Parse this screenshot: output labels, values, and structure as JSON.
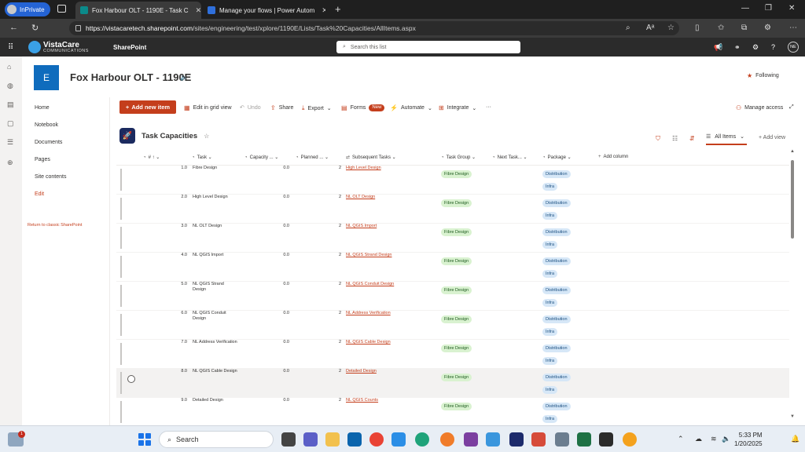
{
  "browser": {
    "inprivate_label": "InPrivate",
    "tabs": [
      {
        "title": "Fox Harbour OLT - 1190E - Task C",
        "active": true
      },
      {
        "title": "Manage your flows | Power Autom",
        "active": false
      }
    ],
    "url_host": "https://vistacaretech.sharepoint.com",
    "url_path": "/sites/engineering/test/xplore/1190E/Lists/Task%20Capacities/AllItems.aspx"
  },
  "suitebar": {
    "brand_name": "VistaCare",
    "brand_sub": "COMMUNICATIONS",
    "app_label": "SharePoint",
    "search_placeholder": "Search this list",
    "me_initials": "NE"
  },
  "site": {
    "logo_letter": "E",
    "title": "Fox Harbour OLT - 1190E",
    "following_label": "Following"
  },
  "leftnav": {
    "items": [
      "Home",
      "Notebook",
      "Documents",
      "Pages",
      "Site contents",
      "Edit"
    ],
    "classic_link": "Return to classic SharePoint"
  },
  "commandbar": {
    "new_item": "Add new item",
    "edit_grid": "Edit in grid view",
    "undo": "Undo",
    "share": "Share",
    "export": "Export",
    "forms": "Forms",
    "forms_badge": "New",
    "automate": "Automate",
    "integrate": "Integrate",
    "more": "···",
    "manage_access": "Manage access"
  },
  "list": {
    "title": "Task Capacities",
    "view_name": "All Items",
    "add_view": "Add view",
    "columns": [
      "#",
      "Task",
      "Capacity ...",
      "Planned ...",
      "Subsequent Tasks",
      "Task Group",
      "Next Task...",
      "Package",
      "Add column"
    ],
    "rows": [
      {
        "num": "1.0",
        "task": "Fibre Design",
        "capacity": "0.0",
        "planned": "2",
        "subsequent": "High Level Design",
        "group": "Fibre Design",
        "pkg1": "Distribution",
        "pkg2": "Infra"
      },
      {
        "num": "2.0",
        "task": "High Level Design",
        "capacity": "0.0",
        "planned": "2",
        "subsequent": "NL OLT Design",
        "group": "Fibre Design",
        "pkg1": "Distribution",
        "pkg2": "Infra"
      },
      {
        "num": "3.0",
        "task": "NL OLT Design",
        "capacity": "0.0",
        "planned": "2",
        "subsequent": "NL QGIS Import",
        "group": "Fibre Design",
        "pkg1": "Distribution",
        "pkg2": "Infra"
      },
      {
        "num": "4.0",
        "task": "NL QGIS Import",
        "capacity": "0.0",
        "planned": "2",
        "subsequent": "NL QGIS Strand Design",
        "group": "Fibre Design",
        "pkg1": "Distribution",
        "pkg2": "Infra"
      },
      {
        "num": "5.0",
        "task": "NL QGIS Strand Design",
        "capacity": "0.0",
        "planned": "2",
        "subsequent": "NL QGIS Conduit Design",
        "group": "Fibre Design",
        "pkg1": "Distribution",
        "pkg2": "Infra"
      },
      {
        "num": "6.0",
        "task": "NL QGIS Conduit Design",
        "capacity": "0.0",
        "planned": "2",
        "subsequent": "NL Address Verification",
        "group": "Fibre Design",
        "pkg1": "Distribution",
        "pkg2": "Infra"
      },
      {
        "num": "7.0",
        "task": "NL Address Verification",
        "capacity": "0.0",
        "planned": "2",
        "subsequent": "NL QGIS Cable Design",
        "group": "Fibre Design",
        "pkg1": "Distribution",
        "pkg2": "Infra"
      },
      {
        "num": "8.0",
        "task": "NL QGIS Cable Design",
        "capacity": "0.0",
        "planned": "2",
        "subsequent": "Detailed Design",
        "group": "Fibre Design",
        "pkg1": "Distribution",
        "pkg2": "Infra"
      },
      {
        "num": "9.0",
        "task": "Detailed Design",
        "capacity": "0.0",
        "planned": "2",
        "subsequent": "NL QGIS Counts",
        "group": "Fibre Design",
        "pkg1": "Distribution",
        "pkg2": "Infra"
      }
    ]
  },
  "taskbar": {
    "weather_badge": "1",
    "search_label": "Search",
    "time": "5:33 PM",
    "date": "1/20/2025"
  },
  "colors": {
    "accent": "#c43e1c",
    "site_logo": "#0f6cbd",
    "pill_green": "#d9f2d0",
    "pill_blue": "#d6e7f7"
  }
}
